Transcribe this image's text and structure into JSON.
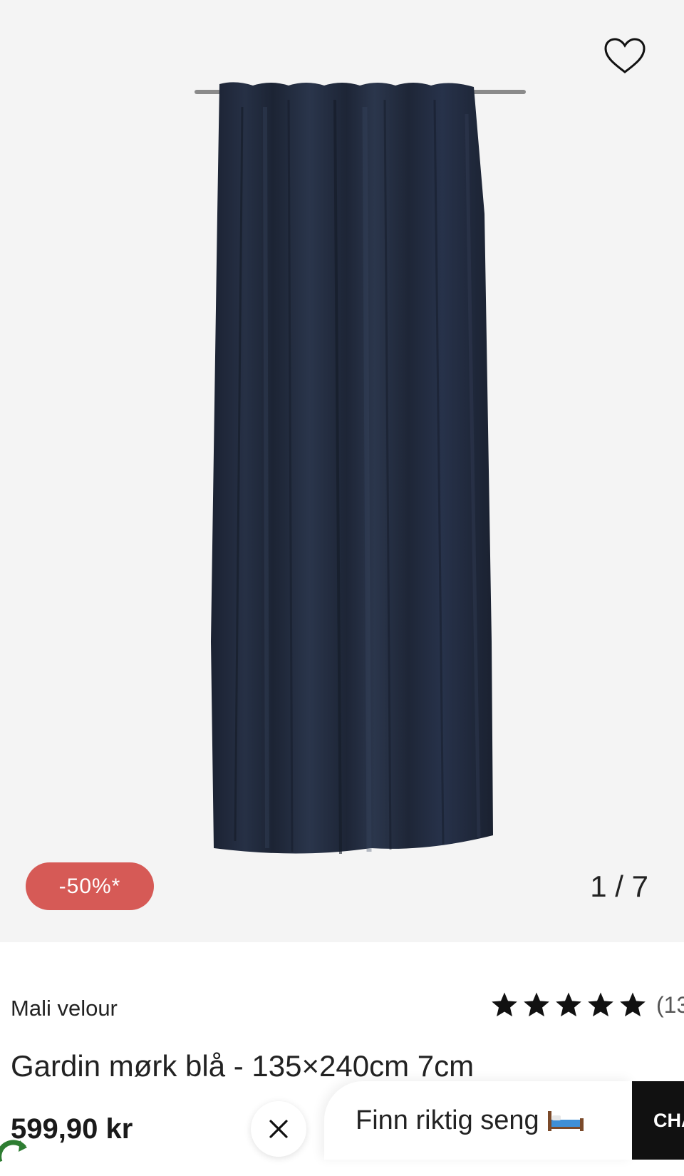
{
  "gallery": {
    "discount": "-50%*",
    "counter": "1 / 7",
    "wishlist_icon": "heart-outline-icon"
  },
  "product": {
    "brand": "Mali velour",
    "rating": 5,
    "review_count": "(13",
    "title": "Gardin mørk blå - 135×240cm 7cm",
    "price": "599,90 kr"
  },
  "footer": {
    "close_icon": "close-icon",
    "bed_finder_label": "Finn riktig seng",
    "chat_label": "CHAT"
  },
  "colors": {
    "discount_badge": "#d65a56",
    "curtain": "#1f2839",
    "gallery_bg": "#f4f4f4",
    "chat_bg": "#111111"
  }
}
